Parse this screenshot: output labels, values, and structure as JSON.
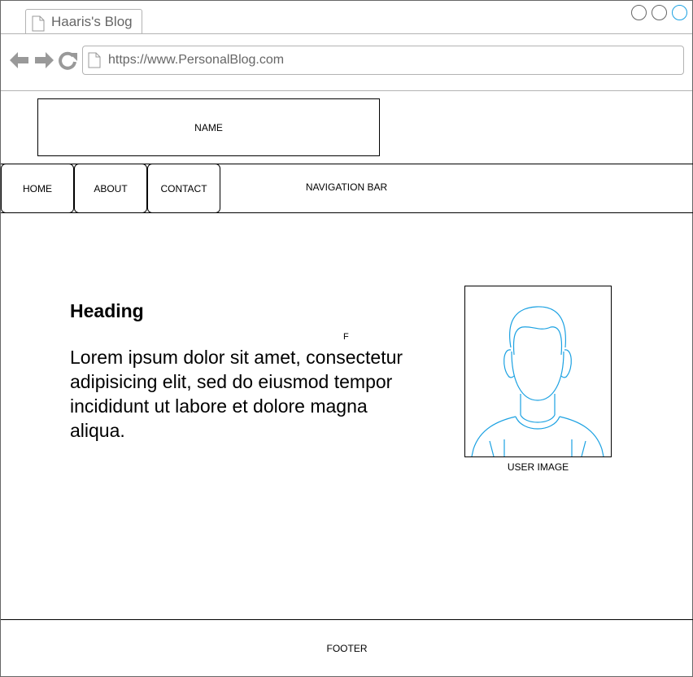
{
  "browser": {
    "tab_title": "Haaris's Blog",
    "url": "https://www.PersonalBlog.com",
    "window_controls": [
      "minimize-circle",
      "maximize-circle",
      "close-circle"
    ],
    "nav_icons": [
      "back-arrow-icon",
      "forward-arrow-icon",
      "reload-icon"
    ],
    "accent_color": "#1ba1e2"
  },
  "header": {
    "name_label": "NAME"
  },
  "nav": {
    "items": [
      {
        "label": "HOME"
      },
      {
        "label": "ABOUT"
      },
      {
        "label": "CONTACT"
      }
    ],
    "bar_label": "NAVIGATION BAR"
  },
  "content": {
    "heading": "Heading",
    "stray_text": "F",
    "body": "Lorem ipsum dolor sit amet, consectetur adipisicing elit, sed do eiusmod tempor incididunt ut labore et dolore magna aliqua.",
    "user_image_label": "USER IMAGE",
    "user_image_icon": "user-avatar-icon"
  },
  "footer": {
    "label": "FOOTER"
  }
}
